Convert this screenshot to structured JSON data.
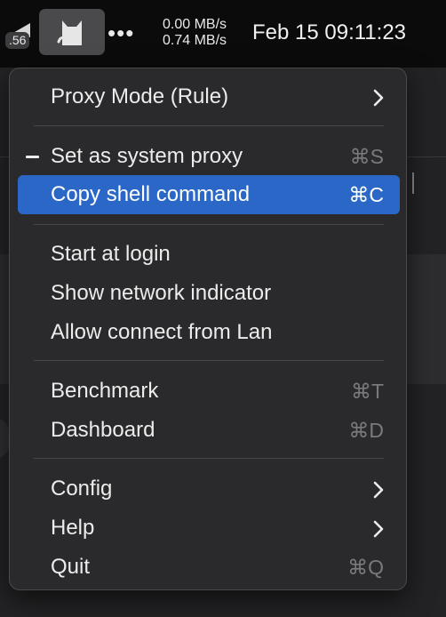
{
  "menubar": {
    "wifi_badge": ".56",
    "network": {
      "upload_speed": "0.00 MB/s",
      "download_speed": "0.74 MB/s"
    },
    "clock": "Feb 15 09:11:23",
    "more_icon": "•••"
  },
  "menu": {
    "items": [
      {
        "label": "Proxy Mode (Rule)",
        "submenu": true
      },
      {
        "label": "Set as system proxy",
        "shortcut": "⌘S",
        "checked": true
      },
      {
        "label": "Copy shell command",
        "shortcut": "⌘C",
        "highlighted": true
      },
      {
        "label": "Start at login"
      },
      {
        "label": "Show network indicator"
      },
      {
        "label": "Allow connect from Lan"
      },
      {
        "label": "Benchmark",
        "shortcut": "⌘T"
      },
      {
        "label": "Dashboard",
        "shortcut": "⌘D"
      },
      {
        "label": "Config",
        "submenu": true
      },
      {
        "label": "Help",
        "submenu": true
      },
      {
        "label": "Quit",
        "shortcut": "⌘Q"
      }
    ]
  },
  "colors": {
    "highlight": "#2a67c6",
    "menu_bg": "#2a2a2c",
    "menubar_bg": "#0b0b0c"
  }
}
